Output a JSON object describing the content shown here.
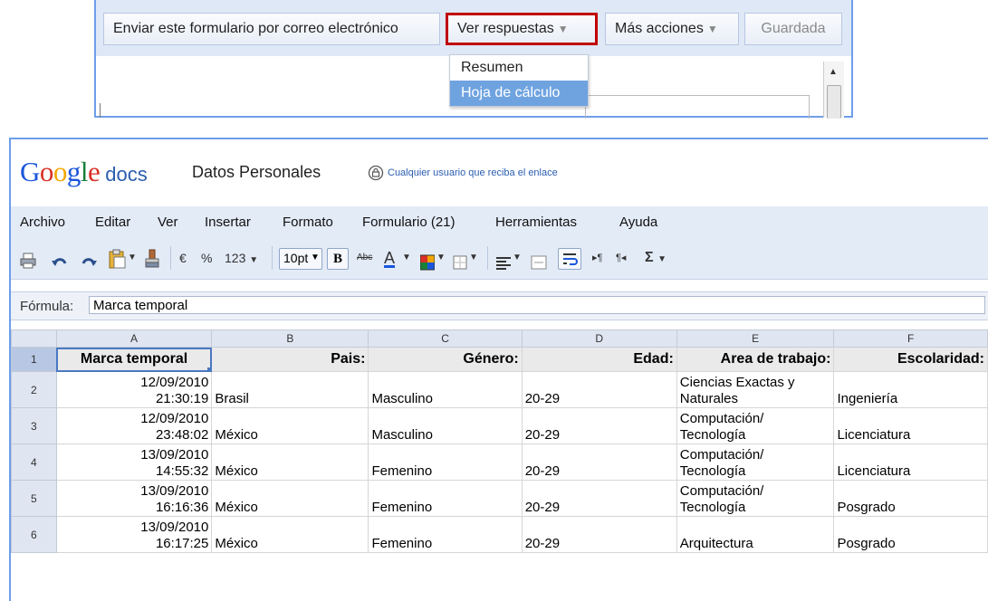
{
  "form": {
    "email_label": "Enviar este formulario por correo electrónico",
    "responses_label": "Ver respuestas",
    "more_label": "Más acciones",
    "saved_label": "Guardada",
    "dropdown": [
      "Resumen",
      "Hoja de cálculo"
    ]
  },
  "header": {
    "logo_google": "Google",
    "logo_docs": "docs",
    "title": "Datos Personales",
    "share_text": "Cualquier usuario que reciba el enlace"
  },
  "menu": [
    "Archivo",
    "Editar",
    "Ver",
    "Insertar",
    "Formato",
    "Formulario (21)",
    "Herramientas",
    "Ayuda"
  ],
  "toolbar": {
    "currency": "€",
    "percent": "%",
    "number_format": "123",
    "font_size": "10pt",
    "bold": "B",
    "strike": "Abc",
    "text_color": "A",
    "sum": "Σ"
  },
  "formula": {
    "label": "Fórmula:",
    "value": "Marca temporal"
  },
  "grid": {
    "columns": [
      "A",
      "B",
      "C",
      "D",
      "E",
      "F"
    ],
    "headers": [
      "Marca temporal",
      "Pais:",
      "Género:",
      "Edad:",
      "Area de trabajo:",
      "Escolaridad:"
    ],
    "rows": [
      {
        "num": "1"
      },
      {
        "num": "2",
        "ts_date": "12/09/2010",
        "ts_time": "21:30:19",
        "pais": "Brasil",
        "genero": "Masculino",
        "edad": "20-29",
        "area_1": "Ciencias Exactas y",
        "area_2": "Naturales",
        "escolaridad": "Ingeniería"
      },
      {
        "num": "3",
        "ts_date": "12/09/2010",
        "ts_time": "23:48:02",
        "pais": "México",
        "genero": "Masculino",
        "edad": "20-29",
        "area_1": "Computación/",
        "area_2": "Tecnología",
        "escolaridad": "Licenciatura"
      },
      {
        "num": "4",
        "ts_date": "13/09/2010",
        "ts_time": "14:55:32",
        "pais": "México",
        "genero": "Femenino",
        "edad": "20-29",
        "area_1": "Computación/",
        "area_2": "Tecnología",
        "escolaridad": "Licenciatura"
      },
      {
        "num": "5",
        "ts_date": "13/09/2010",
        "ts_time": "16:16:36",
        "pais": "México",
        "genero": "Femenino",
        "edad": "20-29",
        "area_1": "Computación/",
        "area_2": "Tecnología",
        "escolaridad": "Posgrado"
      },
      {
        "num": "6",
        "ts_date": "13/09/2010",
        "ts_time": "16:17:25",
        "pais": "México",
        "genero": "Femenino",
        "edad": "20-29",
        "area_1": "",
        "area_2": "Arquitectura",
        "escolaridad": "Posgrado"
      }
    ]
  }
}
